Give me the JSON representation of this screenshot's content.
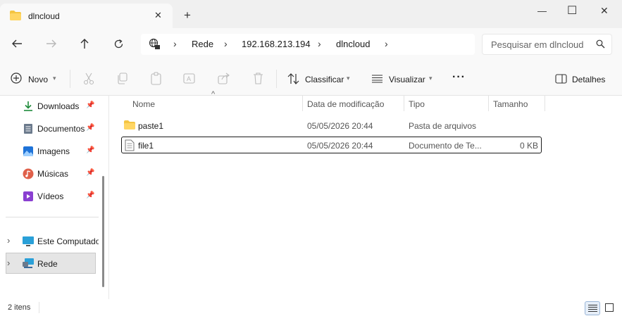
{
  "window": {
    "tab_title": "dlncloud",
    "new_tab": "+",
    "tab_close": "✕",
    "minimize": "—",
    "maximize": "☐",
    "close": "✕"
  },
  "nav": {
    "breadcrumb": [
      "Rede",
      "192.168.213.194",
      "dlncloud"
    ],
    "search_placeholder": "Pesquisar em dlncloud"
  },
  "commands": {
    "new_label": "Novo",
    "sort_label": "Classificar",
    "view_label": "Visualizar",
    "more_label": "···",
    "details_label": "Detalhes"
  },
  "sidebar": {
    "items": [
      {
        "label": "Downloads",
        "icon": "download-icon",
        "color": "#1e8a3a"
      },
      {
        "label": "Documentos",
        "icon": "document-icon",
        "color": "#6b7a8c"
      },
      {
        "label": "Imagens",
        "icon": "image-icon",
        "color": "#1e73d8"
      },
      {
        "label": "Músicas",
        "icon": "music-icon",
        "color": "#e0604a"
      },
      {
        "label": "Vídeos",
        "icon": "video-icon",
        "color": "#8a3fd1"
      }
    ],
    "sections": [
      {
        "label": "Este Computador",
        "icon": "computer-icon"
      },
      {
        "label": "Rede",
        "icon": "network-icon"
      }
    ]
  },
  "table": {
    "columns": [
      "Nome",
      "Data de modificação",
      "Tipo",
      "Tamanho"
    ],
    "rows": [
      {
        "name": "paste1",
        "date": "05/05/2026 20:44",
        "type": "Pasta de arquivos",
        "size": ""
      },
      {
        "name": "file1",
        "date": "05/05/2026 20:44",
        "type": "Documento de Te...",
        "size": "0 KB"
      }
    ]
  },
  "status": {
    "item_count": "2 itens"
  },
  "colors": {
    "folder": "#f4c542",
    "accent": "#0067c0"
  }
}
